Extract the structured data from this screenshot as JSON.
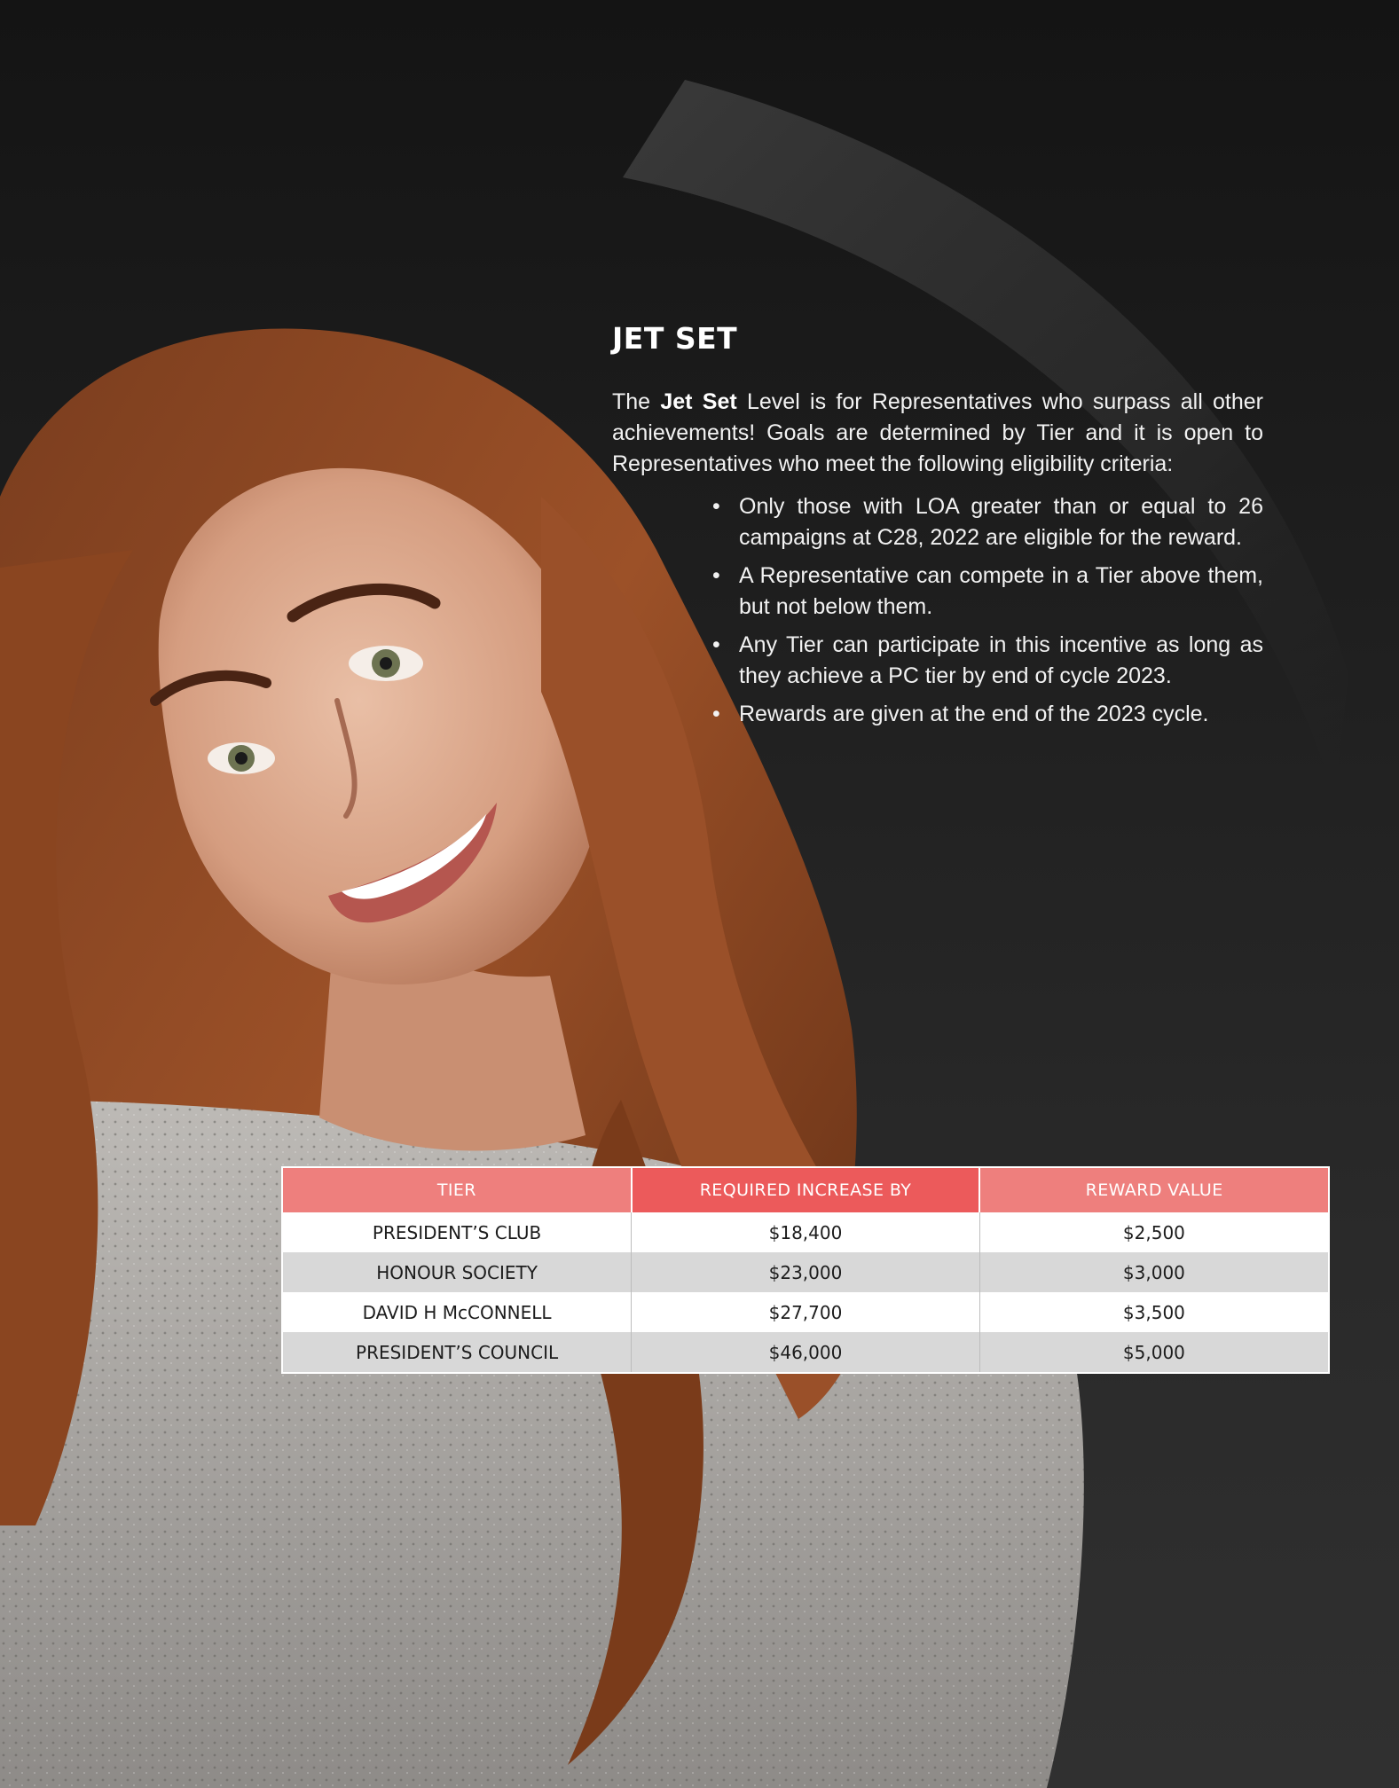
{
  "section": {
    "heading": "JET SET",
    "intro_prefix": "The ",
    "intro_bold": "Jet Set",
    "intro_rest": " Level is for Representatives who surpass all other achievements! Goals are determined by Tier and it is open to Representatives who meet the following eligibility criteria:",
    "bullets": [
      "Only those with LOA greater than or equal to 26 campaigns at C28, 2022 are eligible for the reward.",
      "A Representative can compete in a Tier above them, but not below them.",
      "Any Tier can participate in this incentive as long as they achieve a PC tier by end of cycle 2023.",
      "Rewards are given at the end of the 2023 cycle."
    ]
  },
  "table": {
    "headers": [
      "TIER",
      "REQUIRED INCREASE BY",
      "REWARD VALUE"
    ],
    "rows": [
      [
        "PRESIDENT’S CLUB",
        "$18,400",
        "$2,500"
      ],
      [
        "HONOUR SOCIETY",
        "$23,000",
        "$3,000"
      ],
      [
        "DAVID H McCONNELL",
        "$27,700",
        "$3,500"
      ],
      [
        "PRESIDENT’S COUNCIL",
        "$46,000",
        "$5,000"
      ]
    ]
  },
  "colors": {
    "header_light": "#ee7f7d",
    "header_dark": "#ec5a5b",
    "row_alt": "#d8d8d8"
  }
}
